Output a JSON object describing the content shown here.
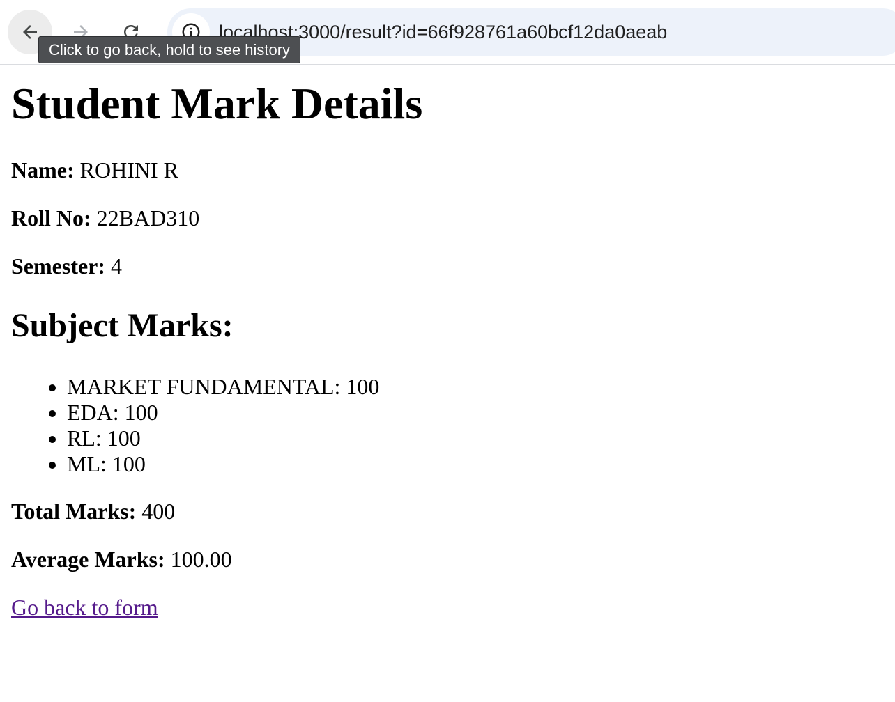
{
  "browser": {
    "url": "localhost:3000/result?id=66f928761a60bcf12da0aeab",
    "back_tooltip": "Click to go back, hold to see history",
    "icons": {
      "back": "arrow-left-icon",
      "forward": "arrow-right-icon",
      "reload": "reload-icon",
      "site_info": "info-icon"
    }
  },
  "page": {
    "title": "Student Mark Details",
    "name_label": "Name:",
    "name_value": "ROHINI R",
    "roll_label": "Roll No:",
    "roll_value": "22BAD310",
    "semester_label": "Semester:",
    "semester_value": "4",
    "subjects_heading": "Subject Marks:",
    "subjects": [
      {
        "text": "MARKET FUNDAMENTAL: 100"
      },
      {
        "text": "EDA: 100"
      },
      {
        "text": "RL: 100"
      },
      {
        "text": "ML: 100"
      }
    ],
    "total_label": "Total Marks:",
    "total_value": "400",
    "average_label": "Average Marks:",
    "average_value": "100.00",
    "back_link": "Go back to form"
  },
  "colors": {
    "link_visited": "#551a8b",
    "omnibox_bg": "#edf2fa",
    "tooltip_bg": "#4d4f52"
  }
}
